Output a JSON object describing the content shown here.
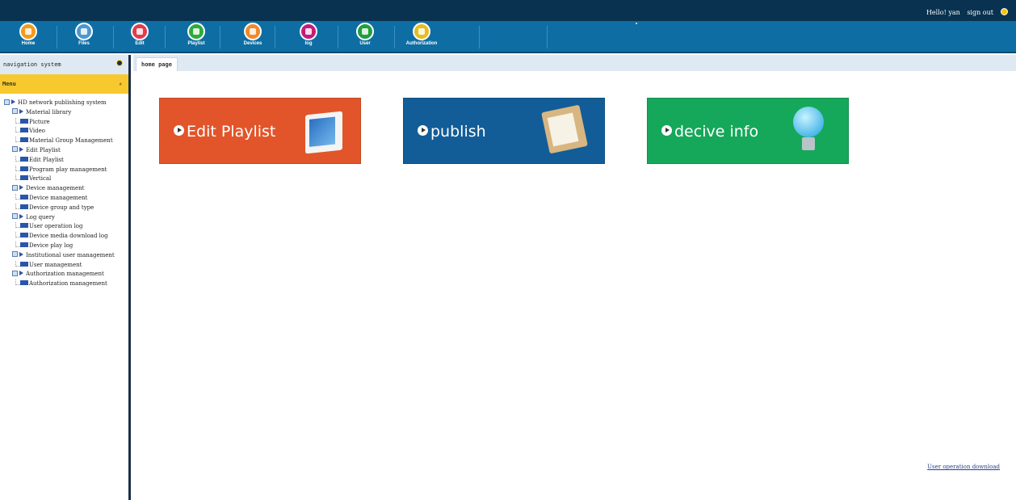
{
  "header": {
    "greeting": "Hello! yan",
    "signout_label": "sign out"
  },
  "nav": {
    "items": [
      {
        "label": "Home",
        "icon": "home-icon",
        "color": "#f39a1e"
      },
      {
        "label": "Files",
        "icon": "files-icon",
        "color": "#4d97cf"
      },
      {
        "label": "Edit",
        "icon": "edit-icon",
        "color": "#e03c4f"
      },
      {
        "label": "Playlist",
        "icon": "playlist-icon",
        "color": "#2eab3a"
      },
      {
        "label": "Devices",
        "icon": "devices-icon",
        "color": "#ee8a2c"
      },
      {
        "label": "log",
        "icon": "log-icon",
        "color": "#c21d7a"
      },
      {
        "label": "User",
        "icon": "user-icon",
        "color": "#1f9f3d"
      },
      {
        "label": "Authorization",
        "icon": "authorization-icon",
        "color": "#e6bd1f"
      }
    ]
  },
  "sidebar": {
    "title": "navigation system",
    "menu_label": "Menu",
    "tree": [
      {
        "label": "HD network publishing system",
        "level": 0
      },
      {
        "label": "Material library",
        "level": 1
      },
      {
        "label": "Picture",
        "level": 2
      },
      {
        "label": "Video",
        "level": 2
      },
      {
        "label": "Material Group Management",
        "level": 2
      },
      {
        "label": "Edit Playlist",
        "level": 1
      },
      {
        "label": "Edit Playlist",
        "level": 2
      },
      {
        "label": "Program play management",
        "level": 2
      },
      {
        "label": "Vertical",
        "level": 2
      },
      {
        "label": "Device management",
        "level": 1
      },
      {
        "label": "Device management",
        "level": 2
      },
      {
        "label": "Device group and type",
        "level": 2
      },
      {
        "label": "Log query",
        "level": 1
      },
      {
        "label": "User operation log",
        "level": 2
      },
      {
        "label": "Device media download log",
        "level": 2
      },
      {
        "label": "Device play log",
        "level": 2
      },
      {
        "label": "Institutional user management",
        "level": 1
      },
      {
        "label": "User management",
        "level": 2
      },
      {
        "label": "Authorization management",
        "level": 1
      },
      {
        "label": "Authorization management",
        "level": 2
      }
    ]
  },
  "main": {
    "tab_label": "home page",
    "tiles": [
      {
        "label": "Edit Playlist",
        "color": "#e2552a"
      },
      {
        "label": "publish",
        "color": "#125d98"
      },
      {
        "label": "decive info",
        "color": "#15a85a"
      }
    ],
    "download_link": "User operation download"
  }
}
